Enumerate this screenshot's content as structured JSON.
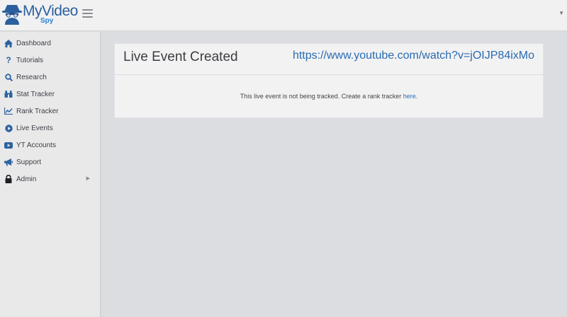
{
  "header": {
    "logo_text": "MyVideo",
    "logo_sub": "Spy"
  },
  "sidebar": {
    "items": [
      {
        "label": "Dashboard",
        "icon": "home-icon"
      },
      {
        "label": "Tutorials",
        "icon": "question-icon"
      },
      {
        "label": "Research",
        "icon": "search-icon"
      },
      {
        "label": "Stat Tracker",
        "icon": "binoculars-icon"
      },
      {
        "label": "Rank Tracker",
        "icon": "line-chart-icon"
      },
      {
        "label": "Live Events",
        "icon": "play-circle-icon"
      },
      {
        "label": "YT Accounts",
        "icon": "youtube-icon"
      },
      {
        "label": "Support",
        "icon": "megaphone-icon"
      },
      {
        "label": "Admin",
        "icon": "lock-icon"
      }
    ]
  },
  "panel": {
    "title": "Live Event Created",
    "url": "https://www.youtube.com/watch?v=jOIJP84ixMo",
    "message": "This live event is not being tracked. Create a rank tracker ",
    "link_label": "here."
  },
  "colors": {
    "accent": "#2b5f9e",
    "link": "#2a6bb0",
    "background": "#dcdde1",
    "sidebar": "#e9e9ea"
  }
}
